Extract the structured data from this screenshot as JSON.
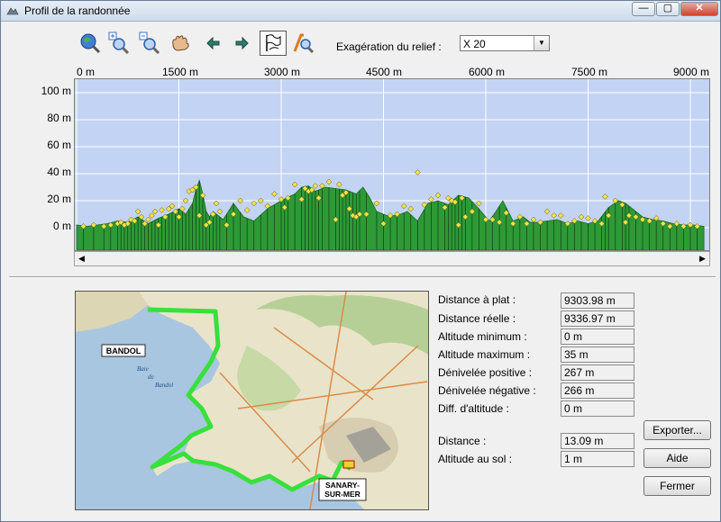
{
  "window": {
    "title": "Profil de la randonnée"
  },
  "titlebar_buttons": {
    "minimize": "—",
    "maximize": "▢",
    "close": "✕"
  },
  "toolbar": {
    "icons": [
      "zoom-globe-icon",
      "zoom-in-icon",
      "zoom-out-icon",
      "pan-hand-icon",
      "arrow-left-icon",
      "arrow-right-icon",
      "flag-profile-icon",
      "path-tool-icon"
    ],
    "exaggeration_label": "Exagération du relief :",
    "exaggeration_value": "X 20"
  },
  "chart_data": {
    "type": "area",
    "x_unit": "m",
    "xlim": [
      0,
      9200
    ],
    "ylim": [
      -10,
      110
    ],
    "x_tick_labels": [
      "0 m",
      "1500 m",
      "3000 m",
      "4500 m",
      "6000 m",
      "7500 m",
      "9000 m"
    ],
    "x_ticks": [
      0,
      1500,
      3000,
      4500,
      6000,
      7500,
      9000
    ],
    "y_tick_labels": [
      "100 m",
      "80 m",
      "60 m",
      "40 m",
      "20 m",
      "0 m"
    ],
    "y_ticks": [
      100,
      80,
      60,
      40,
      20,
      0
    ],
    "grid": true,
    "colors": {
      "fill": "#2e9a36",
      "background": "#c3d3f3",
      "grid": "#ffffff",
      "marker": "#f2e24a"
    },
    "profile": {
      "x": [
        0,
        150,
        300,
        450,
        600,
        750,
        900,
        1050,
        1200,
        1350,
        1500,
        1600,
        1700,
        1750,
        1800,
        1850,
        1900,
        1950,
        2000,
        2150,
        2300,
        2450,
        2600,
        2800,
        3000,
        3200,
        3300,
        3400,
        3500,
        3650,
        3800,
        3950,
        4100,
        4200,
        4300,
        4400,
        4550,
        4700,
        4850,
        5000,
        5150,
        5300,
        5450,
        5600,
        5750,
        5900,
        6050,
        6150,
        6250,
        6400,
        6550,
        6650,
        6750,
        6900,
        7050,
        7200,
        7350,
        7500,
        7650,
        7800,
        7950,
        8050,
        8150,
        8300,
        8450,
        8600,
        8750,
        8900,
        9050,
        9200
      ],
      "y": [
        2,
        1,
        2,
        3,
        5,
        4,
        8,
        3,
        7,
        10,
        14,
        10,
        18,
        28,
        35,
        25,
        12,
        8,
        12,
        6,
        18,
        8,
        5,
        14,
        20,
        25,
        30,
        31,
        27,
        30,
        29,
        28,
        25,
        30,
        22,
        12,
        9,
        9,
        12,
        5,
        18,
        20,
        17,
        24,
        22,
        14,
        5,
        12,
        20,
        5,
        8,
        4,
        4,
        5,
        6,
        3,
        5,
        3,
        5,
        15,
        20,
        18,
        14,
        8,
        6,
        5,
        3,
        2,
        2,
        1
      ]
    },
    "points": {
      "x": [
        100,
        250,
        400,
        500,
        600,
        650,
        700,
        750,
        800,
        850,
        900,
        950,
        1000,
        1050,
        1100,
        1150,
        1200,
        1250,
        1300,
        1350,
        1400,
        1450,
        1500,
        1550,
        1600,
        1650,
        1700,
        1750,
        1800,
        1850,
        1900,
        1950,
        2000,
        2050,
        2100,
        2200,
        2300,
        2400,
        2500,
        2600,
        2700,
        2800,
        2900,
        3000,
        3050,
        3100,
        3200,
        3300,
        3350,
        3400,
        3450,
        3500,
        3550,
        3600,
        3700,
        3800,
        3850,
        3900,
        3950,
        4000,
        4050,
        4100,
        4150,
        4250,
        4400,
        4500,
        4600,
        4700,
        4800,
        4900,
        5000,
        5100,
        5200,
        5300,
        5400,
        5450,
        5500,
        5550,
        5600,
        5650,
        5700,
        5800,
        5900,
        6000,
        6100,
        6200,
        6300,
        6400,
        6500,
        6600,
        6700,
        6800,
        6900,
        7000,
        7100,
        7200,
        7300,
        7400,
        7500,
        7600,
        7700,
        7750,
        7800,
        7900,
        8000,
        8050,
        8100,
        8200,
        8300,
        8400,
        8500,
        8600,
        8700,
        8800,
        8900,
        9000,
        9100
      ],
      "y": [
        1,
        2,
        1,
        2,
        3,
        4,
        2,
        3,
        6,
        5,
        12,
        8,
        3,
        6,
        9,
        12,
        2,
        13,
        8,
        14,
        16,
        12,
        8,
        14,
        20,
        27,
        28,
        30,
        9,
        24,
        2,
        4,
        10,
        18,
        12,
        2,
        10,
        20,
        13,
        18,
        20,
        16,
        25,
        21,
        15,
        22,
        32,
        21,
        29,
        27,
        28,
        31,
        22,
        31,
        34,
        6,
        32,
        24,
        26,
        14,
        9,
        8,
        10,
        10,
        18,
        3,
        9,
        10,
        16,
        14,
        41,
        17,
        21,
        24,
        15,
        22,
        20,
        19,
        2,
        22,
        8,
        12,
        18,
        6,
        6,
        4,
        11,
        3,
        8,
        3,
        6,
        4,
        12,
        9,
        9,
        3,
        5,
        8,
        7,
        5,
        3,
        23,
        9,
        20,
        17,
        4,
        9,
        8,
        6,
        5,
        7,
        3,
        1,
        3,
        1,
        2,
        1
      ]
    }
  },
  "map": {
    "labels": {
      "bandol": "BANDOL",
      "sanary_1": "SANARY-",
      "sanary_2": "SUR-MER",
      "baie_1": "Baie",
      "baie_2": "de",
      "baie_3": "Bandol"
    }
  },
  "stats": [
    {
      "label": "Distance à plat :",
      "value": "9303.98 m"
    },
    {
      "label": "Distance réelle :",
      "value": "9336.97 m"
    },
    {
      "label": "Altitude minimum :",
      "value": "0 m"
    },
    {
      "label": "Altitude maximum :",
      "value": "35 m"
    },
    {
      "label": "Dénivelée positive :",
      "value": "267 m"
    },
    {
      "label": "Dénivelée négative :",
      "value": "266 m"
    },
    {
      "label": "Diff. d'altitude :",
      "value": "0 m"
    }
  ],
  "cursor_info": [
    {
      "label": "Distance :",
      "value": "13.09 m"
    },
    {
      "label": "Altitude au sol :",
      "value": "1 m"
    }
  ],
  "buttons": {
    "export": "Exporter...",
    "help": "Aide",
    "close": "Fermer"
  }
}
